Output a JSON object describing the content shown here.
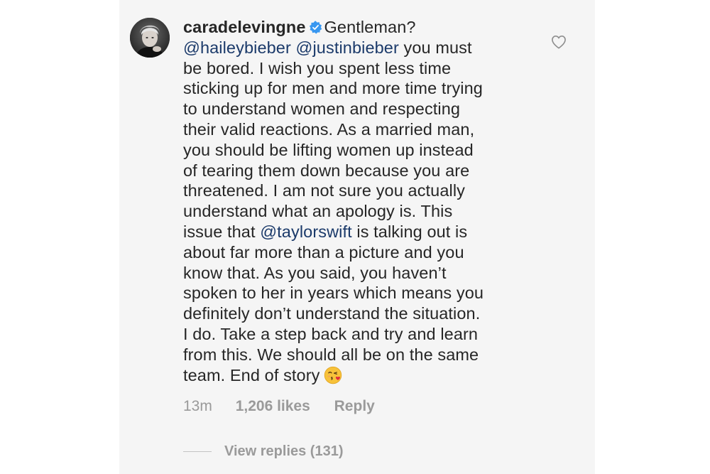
{
  "comment": {
    "username": "caradelevingne",
    "verified": true,
    "lines": [
      {
        "segments": [
          {
            "text": "Gentleman?",
            "type": "text"
          }
        ]
      },
      {
        "segments": [
          {
            "text": "@haileybieber",
            "type": "mention"
          },
          {
            "text": " ",
            "type": "text"
          },
          {
            "text": "@justinbieber",
            "type": "mention"
          },
          {
            "text": " you must",
            "type": "text"
          }
        ]
      },
      {
        "segments": [
          {
            "text": "be bored. I wish you spent less time",
            "type": "text"
          }
        ]
      },
      {
        "segments": [
          {
            "text": "sticking up for men and more time trying",
            "type": "text"
          }
        ]
      },
      {
        "segments": [
          {
            "text": "to understand women and respecting",
            "type": "text"
          }
        ]
      },
      {
        "segments": [
          {
            "text": "their valid reactions. As a married man,",
            "type": "text"
          }
        ]
      },
      {
        "segments": [
          {
            "text": "you should be lifting women up instead",
            "type": "text"
          }
        ]
      },
      {
        "segments": [
          {
            "text": "of tearing them down because you are",
            "type": "text"
          }
        ]
      },
      {
        "segments": [
          {
            "text": "threatened. I am not sure you actually",
            "type": "text"
          }
        ]
      },
      {
        "segments": [
          {
            "text": "understand what an apology is. This",
            "type": "text"
          }
        ]
      },
      {
        "segments": [
          {
            "text": "issue that ",
            "type": "text"
          },
          {
            "text": "@taylorswift",
            "type": "mention"
          },
          {
            "text": " is talking out is",
            "type": "text"
          }
        ]
      },
      {
        "segments": [
          {
            "text": "about far more than a picture and you",
            "type": "text"
          }
        ]
      },
      {
        "segments": [
          {
            "text": "know that. As you said, you haven’t",
            "type": "text"
          }
        ]
      },
      {
        "segments": [
          {
            "text": "spoken to her in years which means you",
            "type": "text"
          }
        ]
      },
      {
        "segments": [
          {
            "text": "definitely don’t understand the situation.",
            "type": "text"
          }
        ]
      },
      {
        "segments": [
          {
            "text": "I do. Take a step back and try and learn",
            "type": "text"
          }
        ]
      },
      {
        "segments": [
          {
            "text": "from this. We should all be on the same",
            "type": "text"
          }
        ]
      },
      {
        "segments": [
          {
            "text": "team. End of story",
            "type": "text"
          },
          {
            "text": "",
            "type": "emoji"
          }
        ]
      }
    ],
    "emoji_icon": "face-blowing-a-kiss-icon"
  },
  "meta": {
    "time": "13m",
    "likes": "1,206 likes",
    "reply_label": "Reply"
  },
  "replies": {
    "label": "View replies (131)"
  },
  "icons": {
    "avatar": "avatar",
    "verified": "verified-badge-icon",
    "like": "heart-outline-icon"
  },
  "colors": {
    "text": "#262626",
    "mention": "#1b3a6a",
    "muted": "#9a9a9a",
    "verified": "#3897f0",
    "panel": "#f5f5f5"
  }
}
